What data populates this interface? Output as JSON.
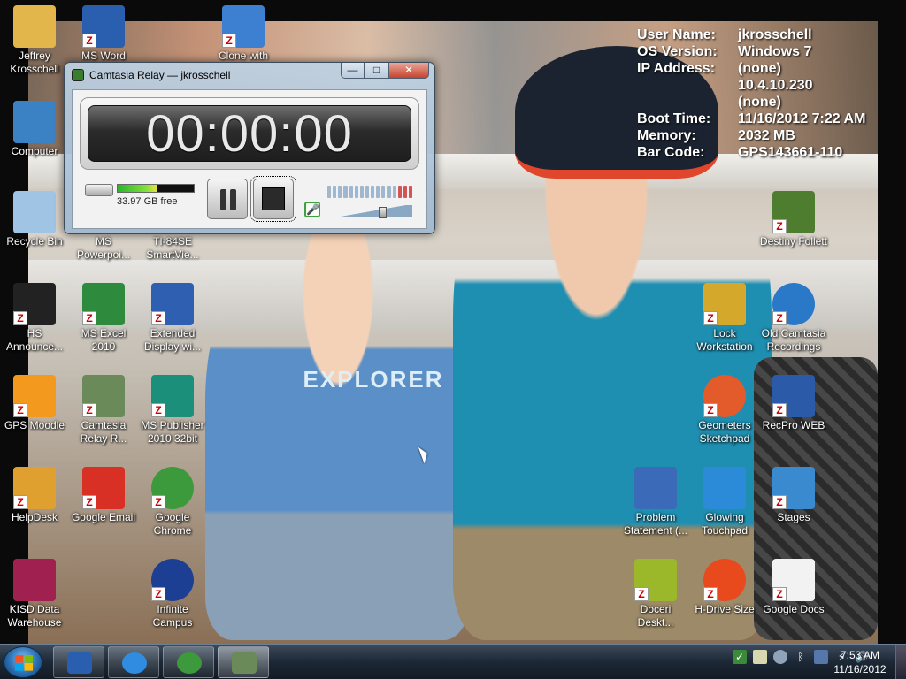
{
  "sysinfo": [
    {
      "key": "User Name:",
      "value": "jkrosschell"
    },
    {
      "key": "OS Version:",
      "value": "Windows 7"
    },
    {
      "key": "IP Address:",
      "value": "(none)"
    },
    {
      "key": "",
      "value": "10.4.10.230"
    },
    {
      "key": "",
      "value": "(none)"
    },
    {
      "key": "Boot Time:",
      "value": "11/16/2012 7:22 AM"
    },
    {
      "key": "Memory:",
      "value": "2032 MB"
    },
    {
      "key": "Bar Code:",
      "value": "GPS143661-110"
    }
  ],
  "wallpaper": {
    "shirt_text": "EXPLORER"
  },
  "icons": {
    "jeffrey": {
      "label": "Jeffrey Krosschell",
      "icon": "user-folder-icon",
      "color": "#e2b64a"
    },
    "msword": {
      "label": "MS Word",
      "icon": "word-icon",
      "color": "#2a5faf"
    },
    "clone": {
      "label": "Clone with",
      "icon": "network-icon",
      "color": "#3d7fd0"
    },
    "computer": {
      "label": "Computer",
      "icon": "computer-icon",
      "color": "#3b82c4"
    },
    "recycle": {
      "label": "Recycle Bin",
      "icon": "recycle-bin-icon",
      "color": "#9fc4e4"
    },
    "powerpoint": {
      "label": "MS Powerpoi...",
      "icon": "powerpoint-icon",
      "color": "#d35b2b"
    },
    "ti84": {
      "label": "TI-84SE SmartVie...",
      "icon": "calculator-icon",
      "color": "#555"
    },
    "hs": {
      "label": "HS Announce...",
      "icon": "announcement-icon",
      "color": "#222"
    },
    "excel": {
      "label": "MS Excel 2010",
      "icon": "excel-icon",
      "color": "#2e8b3e"
    },
    "extended": {
      "label": "Extended Display wi...",
      "icon": "display-icon",
      "color": "#2f5fb0"
    },
    "moodle": {
      "label": "GPS Moodle",
      "icon": "moodle-icon",
      "color": "#f39a1e"
    },
    "relay": {
      "label": "Camtasia Relay R...",
      "icon": "camtasia-relay-icon",
      "color": "#6a8a5a"
    },
    "publisher": {
      "label": "MS Publisher 2010 32bit",
      "icon": "publisher-icon",
      "color": "#1c8f7a"
    },
    "helpdesk": {
      "label": "HelpDesk",
      "icon": "lifebuoy-icon",
      "color": "#e0a030"
    },
    "gmail": {
      "label": "Google Email",
      "icon": "gmail-icon",
      "color": "#d93025"
    },
    "chrome": {
      "label": "Google Chrome",
      "icon": "chrome-icon",
      "color": "#3c9a3c"
    },
    "kisd": {
      "label": "KISD Data Warehouse",
      "icon": "data-warehouse-icon",
      "color": "#a02050"
    },
    "infinite": {
      "label": "Infinite Campus",
      "icon": "campus-icon",
      "color": "#1c3f94"
    },
    "destiny": {
      "label": "Destiny Follett",
      "icon": "tree-icon",
      "color": "#4f7d2f"
    },
    "lock": {
      "label": "Lock Workstation",
      "icon": "lock-icon",
      "color": "#d4a82a"
    },
    "oldcam": {
      "label": "Old Camtasia Recordings",
      "icon": "globe-icon",
      "color": "#2a78c8"
    },
    "geometers": {
      "label": "Geometers Sketchpad",
      "icon": "sketchpad-icon",
      "color": "#e35b2b"
    },
    "recpro": {
      "label": "RecPro WEB",
      "icon": "recpro-icon",
      "color": "#2a5aa8"
    },
    "problem": {
      "label": "Problem Statement (...",
      "icon": "word-document-icon",
      "color": "#3a6ab8"
    },
    "glowing": {
      "label": "Glowing Touchpad",
      "icon": "touchpad-icon",
      "color": "#2b8bd8"
    },
    "stages": {
      "label": "Stages",
      "icon": "stages-icon",
      "color": "#3a8ad0"
    },
    "doceri": {
      "label": "Doceri Deskt...",
      "icon": "doceri-icon",
      "color": "#9ab82a"
    },
    "hdrive": {
      "label": "H-Drive Size",
      "icon": "pie-chart-icon",
      "color": "#e84a1e"
    },
    "gdocs": {
      "label": "Google Docs",
      "icon": "docs-icon",
      "color": "#f2f2f2"
    }
  },
  "camtasia": {
    "title": "Camtasia Relay — jkrosschell",
    "timer": "00:00:00",
    "disk_free": "33.97 GB free",
    "disk_used_fraction": 0.52,
    "buttons": {
      "minimize": "—",
      "maximize": "□",
      "close": "✕"
    },
    "mic_glyph": "🎤"
  },
  "taskbar": {
    "pinned": [
      {
        "name": "word",
        "icon": "word-icon",
        "color": "#2a5faf"
      },
      {
        "name": "ie",
        "icon": "internet-explorer-icon",
        "color": "#2f8ce0"
      },
      {
        "name": "chrome",
        "icon": "chrome-icon",
        "color": "#3c9a3c"
      },
      {
        "name": "camtasia-relay",
        "icon": "camtasia-relay-icon",
        "color": "#6a8a5a"
      }
    ],
    "clock_time": "7:53 AM",
    "clock_date": "11/16/2012",
    "tray_icons": [
      "security-icon",
      "flag-icon",
      "network-status-icon",
      "bluetooth-icon",
      "monitor-icon",
      "power-icon",
      "volume-icon"
    ]
  }
}
